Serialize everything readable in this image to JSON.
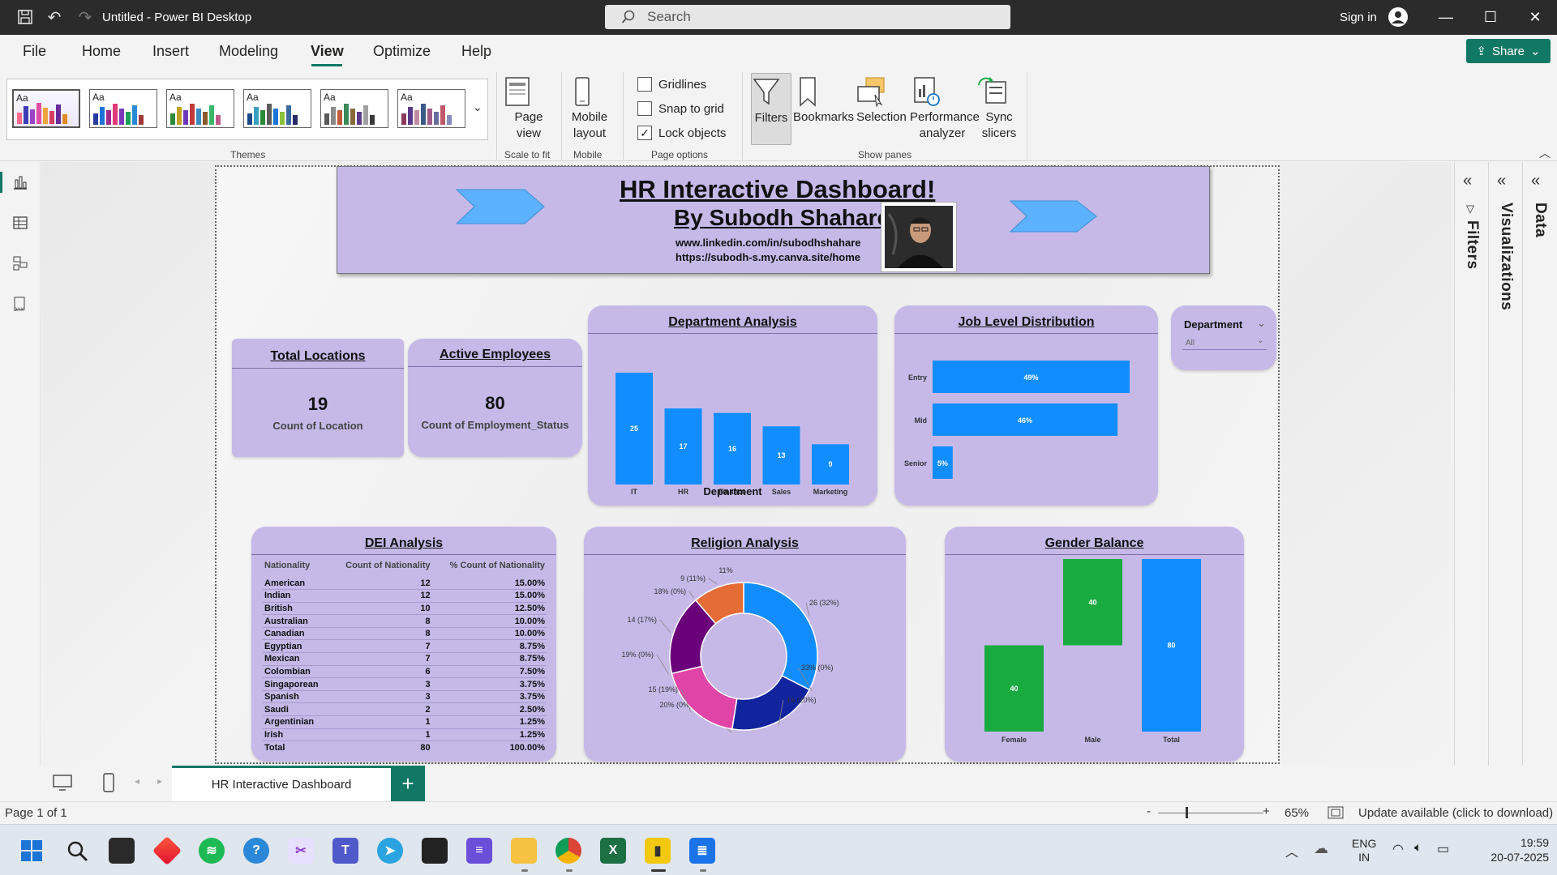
{
  "window": {
    "title": "Untitled - Power BI Desktop",
    "search_placeholder": "Search",
    "sign_in": "Sign in"
  },
  "menu": {
    "items": [
      "File",
      "Home",
      "Insert",
      "Modeling",
      "View",
      "Optimize",
      "Help"
    ],
    "active": "View",
    "share": "Share"
  },
  "ribbon": {
    "themes_label": "Themes",
    "theme_sample": "Aa",
    "page_view": "Page view",
    "scale_to_fit": "Scale to fit",
    "mobile_layout": "Mobile layout",
    "mobile_group": "Mobile",
    "gridlines": "Gridlines",
    "snap_to_grid": "Snap to grid",
    "lock_objects": "Lock objects",
    "page_options": "Page options",
    "filters": "Filters",
    "bookmarks": "Bookmarks",
    "selection": "Selection",
    "performance_analyzer": "Performance analyzer",
    "sync_slicers": "Sync slicers",
    "show_panes": "Show panes",
    "checks": {
      "gridlines": false,
      "snap_to_grid": false,
      "lock_objects": true
    }
  },
  "panes": {
    "filters": "Filters",
    "visualizations": "Visualizations",
    "data": "Data"
  },
  "banner": {
    "title": "HR Interactive Dashboard!",
    "author": "By Subodh Shahare",
    "link1": "www.linkedin.com/in/subodhshahare",
    "link2": "https://subodh-s.my.canva.site/home"
  },
  "kpis": {
    "locations": {
      "title": "Total Locations",
      "value": "19",
      "label": "Count of Location"
    },
    "employees": {
      "title": "Active Employees",
      "value": "80",
      "label": "Count of Employment_Status"
    }
  },
  "slicer": {
    "title": "Department",
    "value": "All"
  },
  "chart_data": [
    {
      "type": "bar",
      "title": "Department Analysis",
      "xlabel": "Department",
      "categories": [
        "IT",
        "HR",
        "Finance",
        "Sales",
        "Marketing"
      ],
      "values": [
        25,
        17,
        16,
        13,
        9
      ],
      "color": "#118dff"
    },
    {
      "type": "bar",
      "orientation": "horizontal",
      "title": "Job Level Distribution",
      "categories": [
        "Entry",
        "Mid",
        "Senior"
      ],
      "values": [
        49,
        46,
        5
      ],
      "labels": [
        "49%",
        "46%",
        "5%"
      ],
      "color": "#118dff"
    },
    {
      "type": "table",
      "title": "DEI Analysis",
      "columns": [
        "Nationality",
        "Count of Nationality",
        "% Count of Nationality"
      ],
      "rows": [
        [
          "American",
          "12",
          "15.00%"
        ],
        [
          "Indian",
          "12",
          "15.00%"
        ],
        [
          "British",
          "10",
          "12.50%"
        ],
        [
          "Australian",
          "8",
          "10.00%"
        ],
        [
          "Canadian",
          "8",
          "10.00%"
        ],
        [
          "Egyptian",
          "7",
          "8.75%"
        ],
        [
          "Mexican",
          "7",
          "8.75%"
        ],
        [
          "Colombian",
          "6",
          "7.50%"
        ],
        [
          "Singaporean",
          "3",
          "3.75%"
        ],
        [
          "Spanish",
          "3",
          "3.75%"
        ],
        [
          "Saudi",
          "2",
          "2.50%"
        ],
        [
          "Argentinian",
          "1",
          "1.25%"
        ],
        [
          "Irish",
          "1",
          "1.25%"
        ]
      ],
      "total": [
        "Total",
        "80",
        "100.00%"
      ]
    },
    {
      "type": "pie",
      "donut": true,
      "title": "Religion Analysis",
      "values": [
        26,
        0,
        16,
        0,
        15,
        0,
        14,
        0,
        9
      ],
      "colors": [
        "#118dff",
        "#118dff",
        "#12239e",
        "#12239e",
        "#e044a7",
        "#e044a7",
        "#6b007b",
        "#6b007b",
        "#e66c37"
      ],
      "labels": [
        "26 (32%)",
        "33% (0%)",
        "16 (20%)",
        "20% (0%)",
        "15 (19%)",
        "19% (0%)",
        "14 (17%)",
        "18% (0%)",
        "9 (11%)"
      ],
      "extra_label": "11% (0%)"
    },
    {
      "type": "bar",
      "subtype": "waterfall",
      "title": "Gender Balance",
      "categories": [
        "Female",
        "Male",
        "Total"
      ],
      "values": [
        40,
        40,
        80
      ],
      "labels": [
        "40",
        "40",
        "80"
      ],
      "colors": [
        "#1aab40",
        "#1aab40",
        "#118dff"
      ]
    }
  ],
  "tabs": {
    "page_tab": "HR Interactive Dashboard",
    "add": "+"
  },
  "status": {
    "page": "Page 1 of 1",
    "zoom": "65%",
    "update": "Update available (click to download)",
    "minus": "-",
    "plus": "+"
  },
  "tray": {
    "lang1": "ENG",
    "lang2": "IN",
    "time": "19:59",
    "date": "20-07-2025"
  }
}
